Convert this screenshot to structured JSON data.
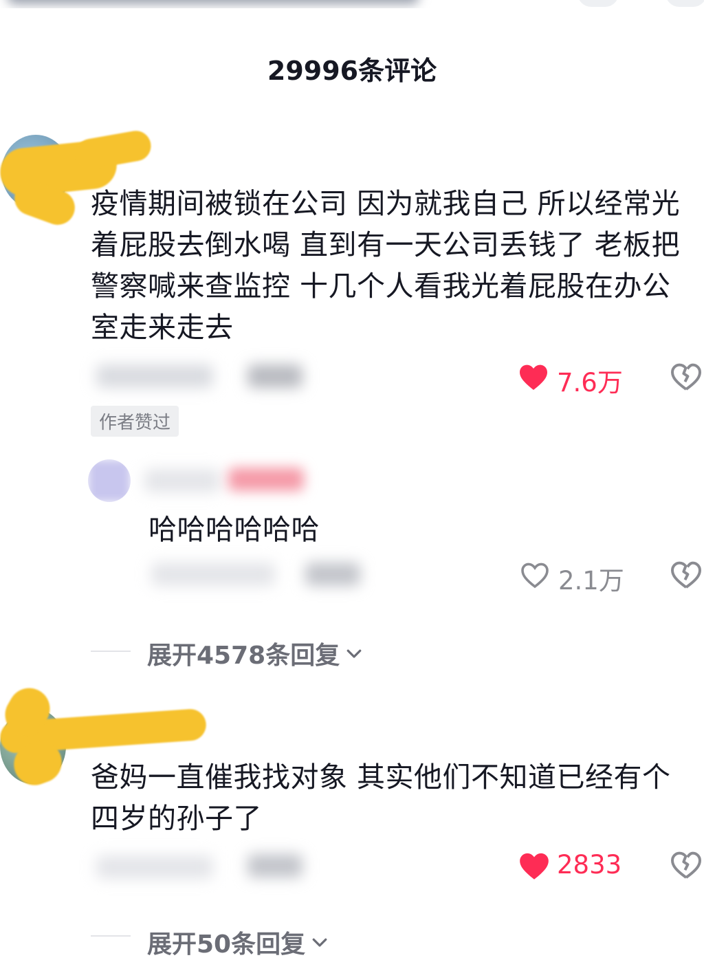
{
  "header": {
    "title": "29996条评论"
  },
  "comments": [
    {
      "text": "疫情期间被锁在公司 因为就我自己 所以经常光着屁股去倒水喝 直到有一天公司丢钱了 老板把警察喊来查监控 十几个人看我光着屁股在办公室走来走去",
      "likes": "7.6万",
      "liked": true,
      "badge": "作者赞过",
      "reply": {
        "text": "哈哈哈哈哈哈",
        "likes": "2.1万",
        "liked": false
      },
      "expand_label": "展开4578条回复"
    },
    {
      "text": "爸妈一直催我找对象 其实他们不知道已经有个四岁的孙子了",
      "likes": "2833",
      "liked": true,
      "expand_label": "展开50条回复"
    }
  ],
  "colors": {
    "like_active": "#fe2c55",
    "like_inactive": "#8a8b91",
    "scribble": "#f6c22e"
  },
  "icons": [
    "heart-filled-icon",
    "heart-outline-icon",
    "broken-heart-icon",
    "chevron-down-icon"
  ]
}
